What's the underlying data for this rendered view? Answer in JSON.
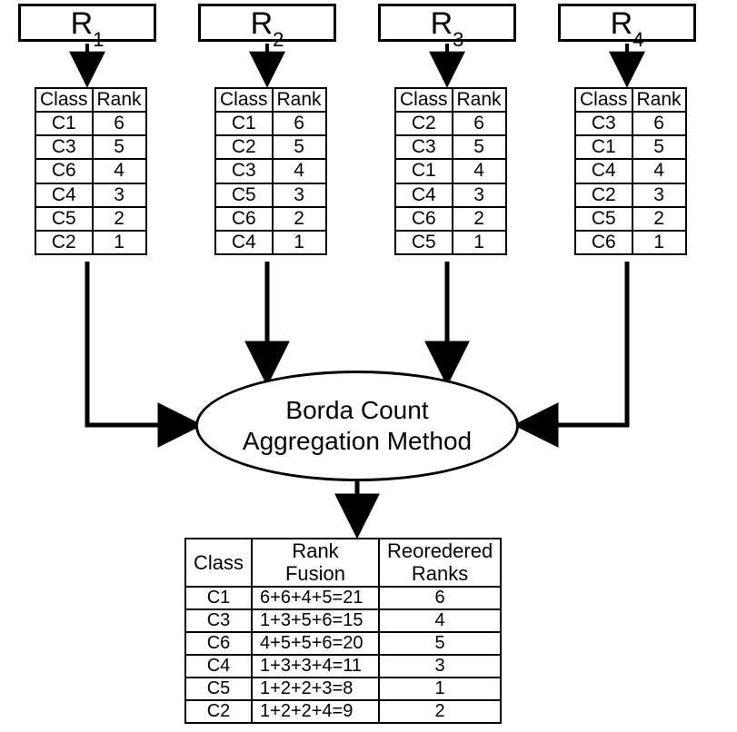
{
  "rankers": [
    "R",
    "R",
    "R",
    "R"
  ],
  "ranker_subs": [
    "1",
    "2",
    "3",
    "4"
  ],
  "rank_tables": {
    "headers": [
      "Class",
      "Rank"
    ],
    "r1": [
      [
        "C1",
        "6"
      ],
      [
        "C3",
        "5"
      ],
      [
        "C6",
        "4"
      ],
      [
        "C4",
        "3"
      ],
      [
        "C5",
        "2"
      ],
      [
        "C2",
        "1"
      ]
    ],
    "r2": [
      [
        "C1",
        "6"
      ],
      [
        "C2",
        "5"
      ],
      [
        "C3",
        "4"
      ],
      [
        "C5",
        "3"
      ],
      [
        "C6",
        "2"
      ],
      [
        "C4",
        "1"
      ]
    ],
    "r3": [
      [
        "C2",
        "6"
      ],
      [
        "C3",
        "5"
      ],
      [
        "C1",
        "4"
      ],
      [
        "C4",
        "3"
      ],
      [
        "C6",
        "2"
      ],
      [
        "C5",
        "1"
      ]
    ],
    "r4": [
      [
        "C3",
        "6"
      ],
      [
        "C1",
        "5"
      ],
      [
        "C4",
        "4"
      ],
      [
        "C2",
        "3"
      ],
      [
        "C5",
        "2"
      ],
      [
        "C6",
        "1"
      ]
    ]
  },
  "method_label_line1": "Borda Count",
  "method_label_line2": "Aggregation Method",
  "result_headers": [
    "Class",
    "Rank Fusion",
    "Reoredered Ranks"
  ],
  "result_rows": [
    [
      "C1",
      "6+6+4+5=21",
      "6"
    ],
    [
      "C3",
      "1+3+5+6=15",
      "4"
    ],
    [
      "C6",
      "4+5+5+6=20",
      "5"
    ],
    [
      "C4",
      "1+3+3+4=11",
      "3"
    ],
    [
      "C5",
      "1+2+2+3=8",
      "1"
    ],
    [
      "C2",
      "1+2+2+4=9",
      "2"
    ]
  ]
}
